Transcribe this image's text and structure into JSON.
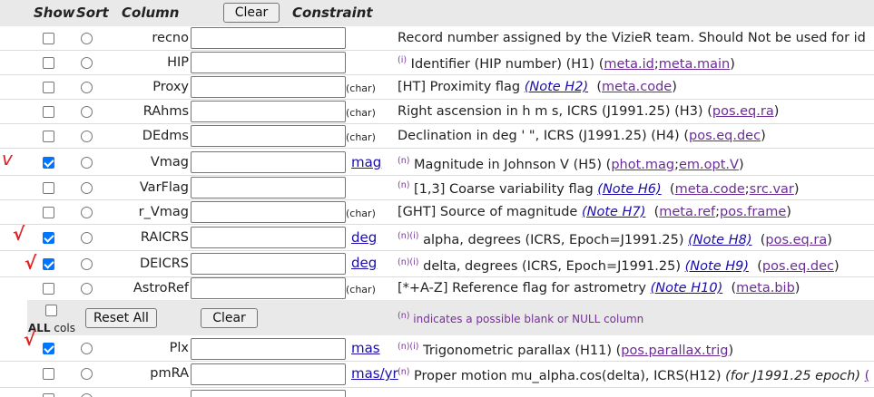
{
  "header": {
    "show": "Show",
    "sort": "Sort",
    "column": "Column",
    "clear": "Clear",
    "constraint": "Constraint"
  },
  "rows": [
    {
      "name": "recno",
      "show": false,
      "unit": "",
      "unit_link": "",
      "flag": "",
      "desc": "Record number assigned by the VizieR team. Should Not be used for id",
      "note": "",
      "ucd1": "",
      "ucd2": ""
    },
    {
      "name": "HIP",
      "show": false,
      "unit": "",
      "unit_link": "",
      "flag": "(i)",
      "desc": "Identifier (HIP number) (H1)",
      "note": "",
      "ucd1": "meta.id",
      "ucd2": "meta.main"
    },
    {
      "name": "Proxy",
      "show": false,
      "unit": "(char)",
      "unit_link": "",
      "flag": "",
      "desc": "[HT] Proximity flag",
      "note": "(Note H2)",
      "ucd1": "meta.code",
      "ucd2": ""
    },
    {
      "name": "RAhms",
      "show": false,
      "unit": "(char)",
      "unit_link": "",
      "flag": "",
      "desc": "Right ascension in h m s, ICRS (J1991.25) (H3)",
      "note": "",
      "ucd1": "pos.eq.ra",
      "ucd2": ""
    },
    {
      "name": "DEdms",
      "show": false,
      "unit": "(char)",
      "unit_link": "",
      "flag": "",
      "desc": "Declination in deg ' \", ICRS (J1991.25) (H4)",
      "note": "",
      "ucd1": "pos.eq.dec",
      "ucd2": ""
    },
    {
      "name": "Vmag",
      "show": true,
      "unit": "",
      "unit_link": "mag",
      "flag": "(n)",
      "desc": "Magnitude in Johnson V (H5)",
      "note": "",
      "ucd1": "phot.mag",
      "ucd2": "em.opt.V"
    },
    {
      "name": "VarFlag",
      "show": false,
      "unit": "",
      "unit_link": "",
      "flag": "(n)",
      "desc": "[1,3] Coarse variability flag",
      "note": "(Note H6)",
      "ucd1": "meta.code",
      "ucd2": "src.var"
    },
    {
      "name": "r_Vmag",
      "show": false,
      "unit": "(char)",
      "unit_link": "",
      "flag": "",
      "desc": "[GHT] Source of magnitude",
      "note": "(Note H7)",
      "ucd1": "meta.ref",
      "ucd2": "pos.frame"
    },
    {
      "name": "RAICRS",
      "show": true,
      "unit": "",
      "unit_link": "deg",
      "flag": "(n)(i)",
      "desc": "alpha, degrees (ICRS, Epoch=J1991.25)",
      "note": "(Note H8)",
      "ucd1": "pos.eq.ra",
      "ucd2": ""
    },
    {
      "name": "DEICRS",
      "show": true,
      "unit": "",
      "unit_link": "deg",
      "flag": "(n)(i)",
      "desc": "delta, degrees (ICRS, Epoch=J1991.25)",
      "note": "(Note H9)",
      "ucd1": "pos.eq.dec",
      "ucd2": ""
    },
    {
      "name": "AstroRef",
      "show": false,
      "unit": "(char)",
      "unit_link": "",
      "flag": "",
      "desc": "[*+A-Z] Reference flag for astrometry",
      "note": "(Note H10)",
      "ucd1": "meta.bib",
      "ucd2": ""
    }
  ],
  "all_bar": {
    "all_label": "ALL",
    "cols_label": "cols",
    "reset": "Reset All",
    "clear": "Clear",
    "blank_flag": "(n)",
    "blank_text": "indicates a possible blank or NULL column"
  },
  "rows2": [
    {
      "name": "Plx",
      "show": true,
      "unit_link": "mas",
      "flag": "(n)(i)",
      "desc": "Trigonometric parallax (H11)",
      "ucd1": "pos.parallax.trig"
    },
    {
      "name": "pmRA",
      "show": false,
      "unit_link": "mas/yr",
      "flag": "(n)",
      "desc": "Proper motion mu_alpha.cos(delta), ICRS(H12)",
      "extra": "(for J1991.25 epoch)",
      "tail": "("
    }
  ],
  "annotations": {
    "check_mark": "√",
    "v_mark": "v"
  }
}
